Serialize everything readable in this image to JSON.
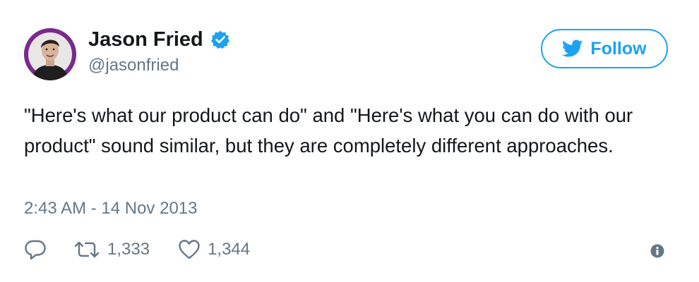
{
  "author": {
    "name": "Jason Fried",
    "handle": "@jasonfried",
    "verified": true,
    "verified_icon": "verified-badge-icon",
    "avatar_icon": "profile-photo"
  },
  "follow_button": {
    "label": "Follow",
    "icon": "twitter-bird-icon"
  },
  "tweet": {
    "text": "\"Here's what our product can do\" and \"Here's what you can do with our product\" sound similar, but they are completely different approaches.",
    "timestamp": "2:43 AM - 14 Nov 2013"
  },
  "actions": {
    "reply_icon": "reply-icon",
    "retweet_icon": "retweet-icon",
    "retweet_count": "1,333",
    "like_icon": "heart-icon",
    "like_count": "1,344",
    "info_icon": "info-icon"
  },
  "colors": {
    "accent": "#1da1f2",
    "secondary_text": "#657786",
    "primary_text": "#14171a",
    "avatar_ring": "#7a2a8c"
  }
}
